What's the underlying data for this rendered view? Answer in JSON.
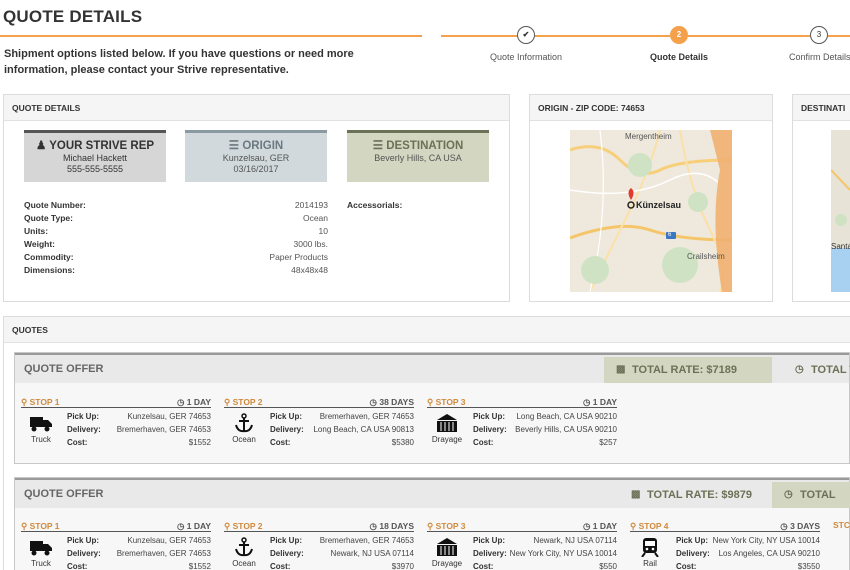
{
  "page": {
    "title": "QUOTE DETAILS",
    "intro": "Shipment options listed below. If you have questions or need more information, please contact your Strive representative."
  },
  "stepper": {
    "steps": [
      {
        "label": "Quote Information",
        "marker": "✔"
      },
      {
        "label": "Quote Details",
        "marker": "2"
      },
      {
        "label": "Confirm Details",
        "marker": "3"
      }
    ]
  },
  "details": {
    "heading": "QUOTE DETAILS",
    "rep": {
      "title": "YOUR STRIVE REP",
      "name": "Michael Hackett",
      "phone": "555-555-5555"
    },
    "origin": {
      "title": "ORIGIN",
      "place": "Kunzelsau, GER",
      "date": "03/16/2017"
    },
    "destination": {
      "title": "DESTINATION",
      "place": "Beverly Hills, CA USA"
    },
    "fields": [
      {
        "label": "Quote Number:",
        "value": "2014193"
      },
      {
        "label": "Quote Type:",
        "value": "Ocean"
      },
      {
        "label": "Units:",
        "value": "10"
      },
      {
        "label": "Weight:",
        "value": "3000 lbs."
      },
      {
        "label": "Commodity:",
        "value": "Paper Products"
      },
      {
        "label": "Dimensions:",
        "value": "48x48x48"
      }
    ],
    "accessorials_label": "Accessorials:"
  },
  "origin_map": {
    "heading": "ORIGIN - ZIP CODE: 74653",
    "labels": {
      "north": "Mergentheim",
      "center": "Künzelsau",
      "east": "Crailsheim",
      "road": "6"
    }
  },
  "destination_map": {
    "heading": "DESTINATI",
    "label": "Santa"
  },
  "quotes": {
    "heading": "QUOTES",
    "offers": [
      {
        "title": "QUOTE OFFER",
        "total_rate": "TOTAL RATE: $7189",
        "total_cut": "TOTAL T",
        "stops": [
          {
            "name": "STOP 1",
            "days": "1 DAY",
            "mode": "Truck",
            "mode_icon": "truck-icon",
            "pickup": "Kunzelsau, GER 74653",
            "delivery": "Bremerhaven, GER 74653",
            "cost": "$1552"
          },
          {
            "name": "STOP 2",
            "days": "38 DAYS",
            "mode": "Ocean",
            "mode_icon": "anchor-icon",
            "pickup": "Bremerhaven, GER 74653",
            "delivery": "Long Beach, CA USA 90813",
            "cost": "$5380"
          },
          {
            "name": "STOP 3",
            "days": "1 DAY",
            "mode": "Drayage",
            "mode_icon": "container-icon",
            "pickup": "Long Beach, CA USA 90210",
            "delivery": "Beverly Hills, CA USA 90210",
            "cost": "$257"
          }
        ]
      },
      {
        "title": "QUOTE OFFER",
        "total_rate": "TOTAL RATE: $9879",
        "total_cut": "TOTAL",
        "stops": [
          {
            "name": "STOP 1",
            "days": "1 DAY",
            "mode": "Truck",
            "mode_icon": "truck-icon",
            "pickup": "Kunzelsau, GER 74653",
            "delivery": "Bremerhaven, GER 74653",
            "cost": "$1552"
          },
          {
            "name": "STOP 2",
            "days": "18 DAYS",
            "mode": "Ocean",
            "mode_icon": "anchor-icon",
            "pickup": "Bremerhaven, GER 74653",
            "delivery": "Newark, NJ USA 07114",
            "cost": "$3970"
          },
          {
            "name": "STOP 3",
            "days": "1 DAY",
            "mode": "Drayage",
            "mode_icon": "container-icon",
            "pickup": "Newark, NJ USA 07114",
            "delivery": "New York City, NY USA 10014",
            "cost": "$550"
          },
          {
            "name": "STOP 4",
            "days": "3 DAYS",
            "mode": "Rail",
            "mode_icon": "train-icon",
            "pickup": "New York City, NY USA 10014",
            "delivery": "Los Angeles, CA USA 90210",
            "cost": "$3550"
          }
        ],
        "stop_cut": "STC"
      }
    ],
    "row_labels": {
      "pickup": "Pick Up:",
      "delivery": "Delivery:",
      "cost": "Cost:"
    }
  },
  "colors": {
    "accent": "#f5a04a",
    "olive": "#6b7156",
    "rate_bg": "#d3d6c0"
  }
}
